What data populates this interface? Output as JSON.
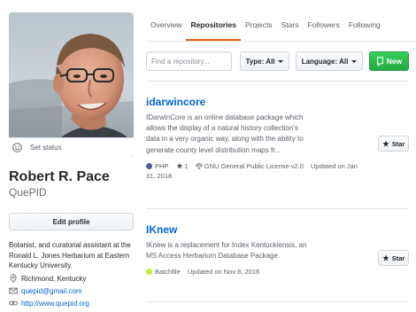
{
  "profile": {
    "set_status": "Set status",
    "name": "Robert R. Pace",
    "login": "QuePID",
    "edit_profile": "Edit profile",
    "bio": "Botanist, and curatorial assistant at the Ronald L. Jones Herbarium at Eastern Kentucky University.",
    "location": "Richmond, Kentucky",
    "email": "quepid@gmail.com",
    "website": "http://www.quepid.org"
  },
  "tabs": [
    {
      "label": "Overview"
    },
    {
      "label": "Repositories"
    },
    {
      "label": "Projects"
    },
    {
      "label": "Stars"
    },
    {
      "label": "Followers"
    },
    {
      "label": "Following"
    }
  ],
  "filter": {
    "search_placeholder": "Find a repository...",
    "type_label": "Type: All",
    "language_label": "Language: All",
    "new_label": "New"
  },
  "repos": [
    {
      "name": "idarwincore",
      "description": "IDarwinCore is an online database package which allows the display of a natural history collection's data in a very organic way, along with the ability to generate county level distribution maps fr...",
      "language": "PHP",
      "language_color": "#4F5D95",
      "stars": "1",
      "license": "GNU General Public License v2.0",
      "updated": "Updated on Jan 31, 2018",
      "star_label": "Star"
    },
    {
      "name": "IKnew",
      "description": "IKnew is a replacement for Index Kentuckiensis, an MS Access Herbarium Database Package.",
      "language": "Batchfile",
      "language_color": "#C1F12E",
      "updated": "Updated on Nov 8, 2016",
      "star_label": "Star"
    }
  ],
  "colors": {
    "link": "#0366d6",
    "tab_underline": "#e36209",
    "new_button": "#28a745"
  },
  "icons": {
    "status": "smiley-icon",
    "location": "location-pin-icon",
    "email": "mail-icon",
    "website": "link-icon",
    "star": "star-icon",
    "license": "law-icon",
    "new": "repo-icon"
  }
}
